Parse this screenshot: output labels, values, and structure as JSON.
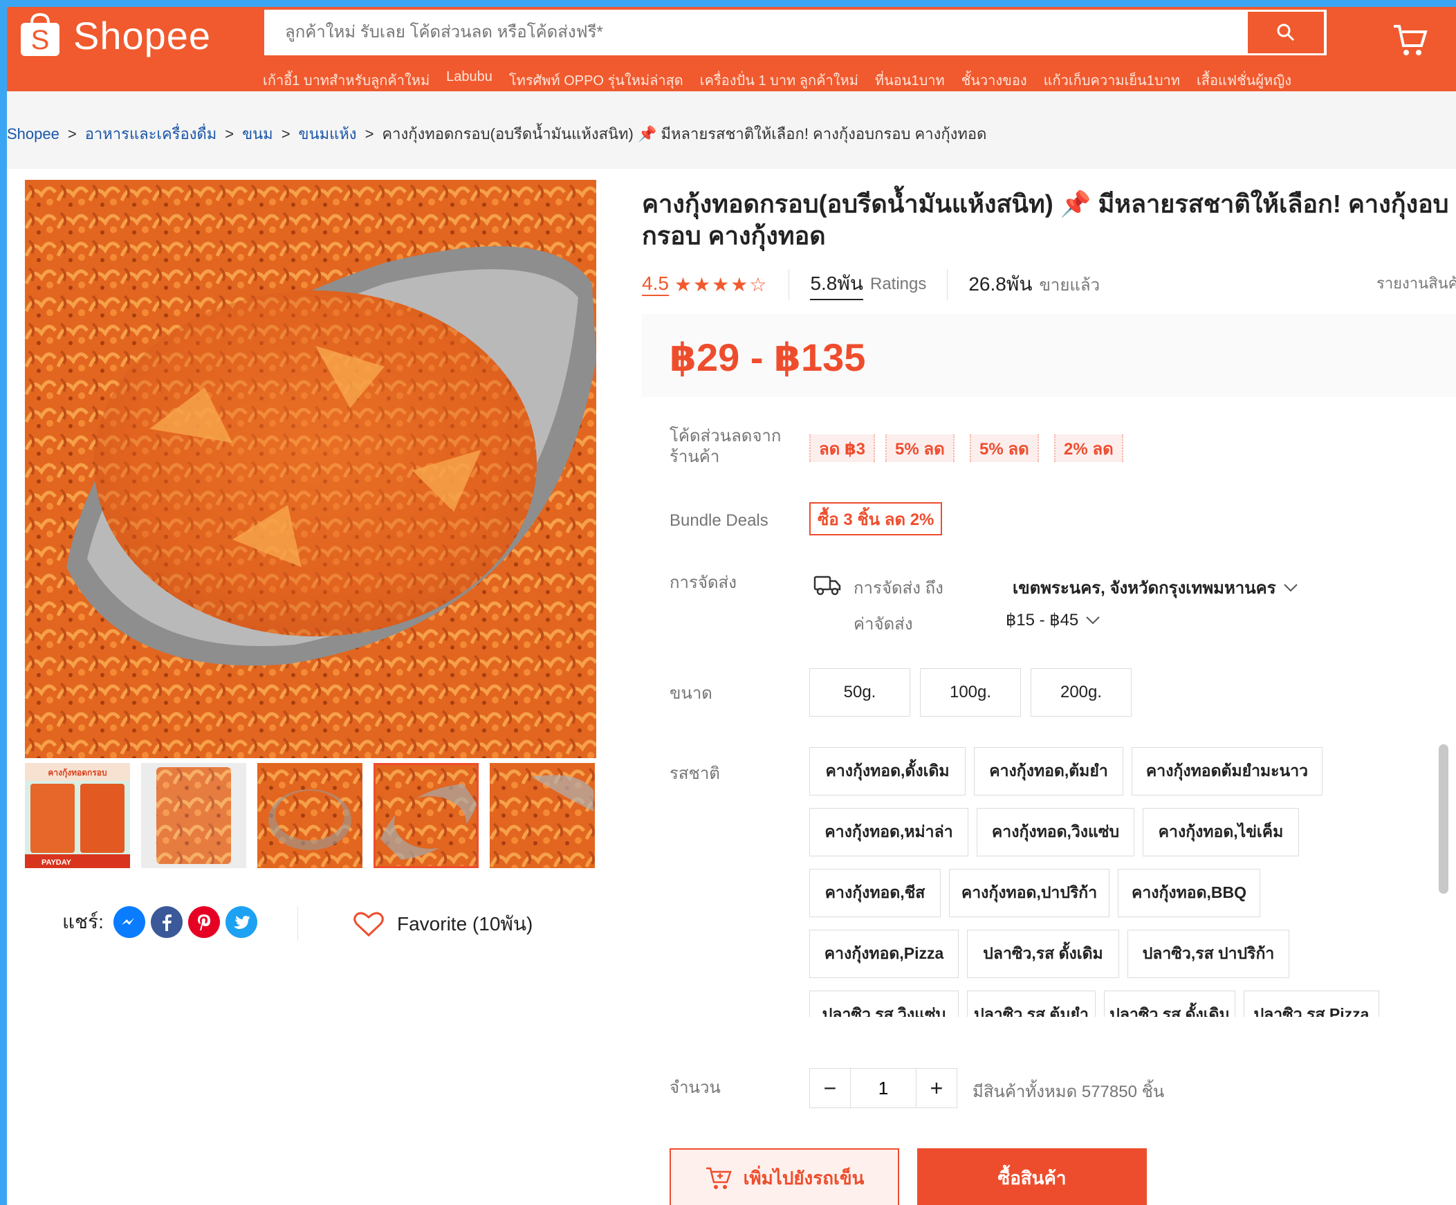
{
  "header": {
    "logo_text": "Shopee",
    "search_placeholder": "ลูกค้าใหม่ รับเลย โค้ดส่วนลด หรือโค้ดส่งฟรี*",
    "quick_links": [
      "เก้าอี้1 บาทสำหรับลูกค้าใหม่",
      "Labubu",
      "โทรศัพท์ OPPO รุ่นใหม่ล่าสุด",
      "เครื่องปั่น 1 บาท ลูกค้าใหม่",
      "ที่นอน1บาท",
      "ชั้นวางของ",
      "แก้วเก็บความเย็น1บาท",
      "เสื้อแฟชั่นผู้หญิง"
    ]
  },
  "breadcrumb": {
    "items": [
      "Shopee",
      "อาหารและเครื่องดื่ม",
      "ขนม",
      "ขนมแห้ง"
    ],
    "current": "คางกุ้งทอดกรอบ(อบรีดน้ำมันแห้งสนิท) 📌 มีหลายรสชาติให้เลือก! คางกุ้งอบกรอบ คางกุ้งทอด"
  },
  "product": {
    "title": "คางกุ้งทอดกรอบ(อบรีดน้ำมันแห้งสนิท) 📌 มีหลายรสชาติให้เลือก! คางกุ้งอบกรอบ คางกุ้งทอด",
    "rating": "4.5",
    "stars": "★★★★☆",
    "rating_value": 4.5,
    "ratings_count": "5.8พัน",
    "ratings_label": "Ratings",
    "sold_count": "26.8พัน",
    "sold_label": "ขายแล้ว",
    "report_label": "รายงานสินค้า",
    "price": "฿29 - ฿135"
  },
  "gallery": {
    "thumb_banner_text": "คางกุ้งทอดกรอบ",
    "thumb_footer_text": "PAYDAY"
  },
  "share": {
    "label": "แชร์:",
    "favorite_label": "Favorite (10พัน)"
  },
  "vouchers": {
    "label": "โค้ดส่วนลดจากร้านค้า",
    "items": [
      "ลด ฿3",
      "5% ลด",
      "5% ลด",
      "2% ลด"
    ]
  },
  "bundle": {
    "label": "Bundle Deals",
    "tag": "ซื้อ 3 ชิ้น ลด 2%"
  },
  "shipping": {
    "label": "การจัดส่ง",
    "to_label": "การจัดส่ง ถึง",
    "to_value": "เขตพระนคร, จังหวัดกรุงเทพมหานคร",
    "fee_label": "ค่าจัดส่ง",
    "fee_value": "฿15 - ฿45"
  },
  "size": {
    "label": "ขนาด",
    "options": [
      "50g.",
      "100g.",
      "200g."
    ]
  },
  "flavor": {
    "label": "รสชาติ",
    "options": [
      "คางกุ้งทอด,ดั้งเดิม",
      "คางกุ้งทอด,ต้มยำ",
      "คางกุ้งทอดต้มยำมะนาว",
      "คางกุ้งทอด,หม่าล่า",
      "คางกุ้งทอด,วิงแซ่บ",
      "คางกุ้งทอด,ไข่เค็ม",
      "คางกุ้งทอด,ชีส",
      "คางกุ้งทอด,ปาปริก้า",
      "คางกุ้งทอด,BBQ",
      "คางกุ้งทอด,Pizza",
      "ปลาซิว,รส ดั้งเดิม",
      "ปลาซิว,รส ปาปริก้า",
      "ปลาซิว,รส วิงแซ่บ",
      "ปลาซิว,รส ต้มยำ",
      "ปลาซิว,รส ดั้งเดิม",
      "ปลาซิว,รส Pizza"
    ]
  },
  "quantity": {
    "label": "จำนวน",
    "minus": "−",
    "value": "1",
    "plus": "+",
    "stock_text": "มีสินค้าทั้งหมด 577850 ชิ้น"
  },
  "actions": {
    "add_to_cart": "เพิ่มไปยังรถเข็น",
    "buy_now": "ซื้อสินค้า"
  },
  "colors": {
    "brand": "#f05a2e",
    "price": "#ee4d2d",
    "frame": "#3aa6f3"
  }
}
